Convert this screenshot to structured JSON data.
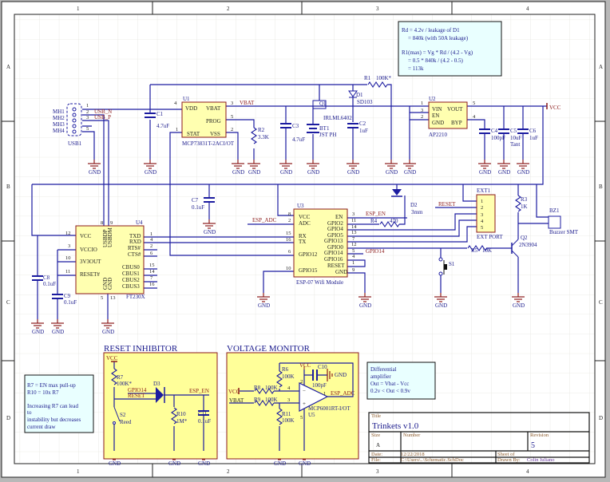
{
  "sheet": {
    "zones_x": [
      "1",
      "2",
      "3",
      "4"
    ],
    "zones_y": [
      "A",
      "B",
      "C",
      "D"
    ]
  },
  "common": {
    "gnd": "GND",
    "vcc": "VCC"
  },
  "usb": {
    "ref": "USB1",
    "mh": [
      "MH1",
      "MH2",
      "MH3",
      "MH4"
    ],
    "pins": [
      "1",
      "2",
      "3",
      "5"
    ],
    "net_n": "USB_N",
    "net_p": "USB_P"
  },
  "u1": {
    "ref": "U1",
    "part": "MCP73831T-2ACI/OT",
    "vdd": "VDD",
    "vbat": "VBAT",
    "prog": "PROG",
    "stat": "STAT",
    "vss": "VSS",
    "pins": [
      "4",
      "3",
      "5",
      "2",
      "1"
    ],
    "net": "VBAT"
  },
  "c1": {
    "ref": "C1",
    "value": "4.7uF"
  },
  "r2": {
    "ref": "R2",
    "value": "3.3K"
  },
  "c3": {
    "ref": "C3",
    "value": "4.7uF"
  },
  "q1": {
    "ref": "Q1",
    "part": "IRLML6402"
  },
  "bt1": {
    "ref": "BT1",
    "part": "JST PH"
  },
  "d1": {
    "ref": "D1",
    "part": "SD103"
  },
  "c2": {
    "ref": "C2",
    "value": "1uF"
  },
  "r1": {
    "ref": "R1",
    "value": "100K*"
  },
  "u2": {
    "ref": "U2",
    "part": "AP2210",
    "vin": "VIN",
    "vout": "VOUT",
    "en": "EN",
    "gnd": "GND",
    "byp": "BYP",
    "pins": [
      "1",
      "3",
      "2",
      "5",
      "4"
    ]
  },
  "c4": {
    "ref": "C4",
    "value": "100pF"
  },
  "c5": {
    "ref": "C5",
    "value": "10uF",
    "note": "Tant"
  },
  "c6": {
    "ref": "C6",
    "value": "1uF"
  },
  "note_rd": {
    "lines": [
      "Rd = 4.2v / leakage of D1",
      "= 840k (with 50A leakage)",
      "R1(max) = Vg * Rd / (4.2 - Vg)",
      "= 0.5 * 840k / (4.2 - 0.5)",
      "= 113k"
    ]
  },
  "c7": {
    "ref": "C7",
    "value": "0.1uF"
  },
  "u4": {
    "ref": "U4",
    "part": "FT230X",
    "left": [
      "VCC",
      "VCCIO",
      "3V3OUT",
      "RESET#"
    ],
    "right": [
      "TXD",
      "RXD",
      "RTS#",
      "CTS#",
      "CBUS0",
      "CBUS1",
      "CBUS2",
      "CBUS3"
    ],
    "top": [
      "USBDP",
      "USBDM"
    ],
    "bottom": [
      "GND",
      "GND"
    ],
    "left_pins": [
      "12",
      "3",
      "10",
      "11"
    ],
    "right_pins": [
      "1",
      "4",
      "2",
      "6",
      "15",
      "14",
      "7",
      "16"
    ],
    "top_pins": [
      "8",
      "9"
    ],
    "bottom_pins": [
      "5",
      "13"
    ]
  },
  "c8": {
    "ref": "C8",
    "value": "0.1uF"
  },
  "c9": {
    "ref": "C9",
    "value": "0.1uF"
  },
  "u3": {
    "ref": "U3",
    "part": "ESP-07 Wifi Module",
    "left": [
      "VCC",
      "ADC",
      "RX",
      "TX",
      "GPIO12",
      "GPIO15"
    ],
    "right": [
      "EN",
      "GPIO2",
      "GPIO4",
      "GPIO5",
      "GPIO13",
      "GPIO0",
      "GPIO14",
      "GPIO16",
      "RESET",
      "GND"
    ],
    "left_pins": [
      "8",
      "2",
      "15",
      "16",
      "6",
      "10"
    ],
    "right_pins": [
      "3",
      "11",
      "14",
      "13",
      "7",
      "12",
      "5",
      "4",
      "1",
      "9"
    ]
  },
  "nets": {
    "esp_adc": "ESP_ADC",
    "esp_en": "ESP_EN",
    "gpio14": "GPIO14",
    "reset": "RESET"
  },
  "r4": {
    "ref": "R4",
    "value": "470"
  },
  "d2": {
    "ref": "D2",
    "value": "3mm"
  },
  "ext1": {
    "ref": "EXT1",
    "part": "EXT PORT",
    "pins": [
      "1",
      "2",
      "3",
      "4",
      "5"
    ]
  },
  "r3": {
    "ref": "R3",
    "value": "1K"
  },
  "bz1": {
    "ref": "BZ1",
    "part": "Buzzer SMT"
  },
  "q2": {
    "ref": "Q2",
    "part": "2N3904"
  },
  "r5": {
    "ref": "R5",
    "value": "10K"
  },
  "s1": {
    "ref": "S1"
  },
  "reset_inhibitor": {
    "title": "RESET INHIBITOR",
    "r7": {
      "ref": "R7",
      "value": "100K*"
    },
    "s2": {
      "ref": "S2",
      "value": "Reed"
    },
    "d3": {
      "ref": "D3"
    },
    "r10": {
      "ref": "R10",
      "value": "1M*"
    },
    "c11": {
      "ref": "C11",
      "value": "0.1uF"
    },
    "gpio14": "GPIO14",
    "reset": "RESET",
    "esp_en": "ESP_EN"
  },
  "voltage_monitor": {
    "title": "VOLTAGE MONITOR",
    "r6": {
      "ref": "R6",
      "value": "100K"
    },
    "r8": {
      "ref": "R8",
      "value": "100K"
    },
    "r9": {
      "ref": "R9",
      "value": "100K"
    },
    "r11": {
      "ref": "R11",
      "value": "100K"
    },
    "c10": {
      "ref": "C10",
      "value": "100pF"
    },
    "u5": {
      "ref": "U5",
      "part": "MCP6001RT-I/OT",
      "pins": [
        "4",
        "3",
        "1",
        "2",
        "5"
      ]
    },
    "vbat": "VBAT",
    "esp_adc": "ESP_ADC"
  },
  "note_r7": {
    "lines": [
      "R7 = EN max pull-up",
      "R10 = 10x R7",
      "Increasing R7 can lead",
      "to",
      "instability but decreases",
      "current draw"
    ]
  },
  "note_diff": {
    "lines": [
      "Differential",
      "amplifier",
      "Out = Vbat - Vcc",
      "0.2v < Out < 0.9v"
    ]
  },
  "title_block": {
    "title_label": "Title",
    "title": "Trinkets v1.0",
    "size_label": "Size",
    "size": "A",
    "number_label": "Number",
    "number": "",
    "revision_label": "Revision",
    "revision": "5",
    "date_label": "Date:",
    "date": "12/22/2018",
    "sheet_label": "Sheet    of",
    "file_label": "File:",
    "file": "C:\\Users\\..\\Schematic.SchDoc",
    "drawn_label": "Drawn By:",
    "drawn_by": "Colin Iuliano"
  }
}
